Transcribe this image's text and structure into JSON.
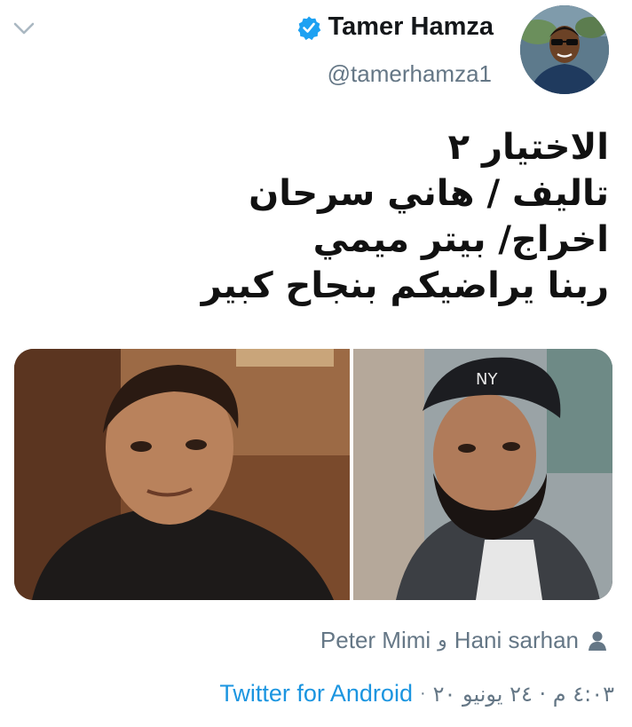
{
  "author": {
    "display_name": "Tamer Hamza",
    "handle": "@tamerhamza1",
    "verified": true
  },
  "icons": {
    "menu": "chevron-down-icon",
    "verified": "verified-badge-icon",
    "tagged": "person-icon"
  },
  "tweet": {
    "lines": [
      "الاختيار ٢",
      "تاليف / هاني سرحان",
      "اخراج/ بيتر ميمي",
      "ربنا يراضيكم بنجاح كبير"
    ]
  },
  "tagged": {
    "person1": "Peter Mimi",
    "separator": "و",
    "person2": "Hani sarhan"
  },
  "footer": {
    "datetime": "٤:٠٣ م · ٢٤ يونيو ٢٠",
    "separator": "·",
    "source": "Twitter for Android"
  },
  "colors": {
    "link_blue": "#1b95e0",
    "secondary_text": "#657786",
    "verified_blue": "#1da1f2"
  }
}
